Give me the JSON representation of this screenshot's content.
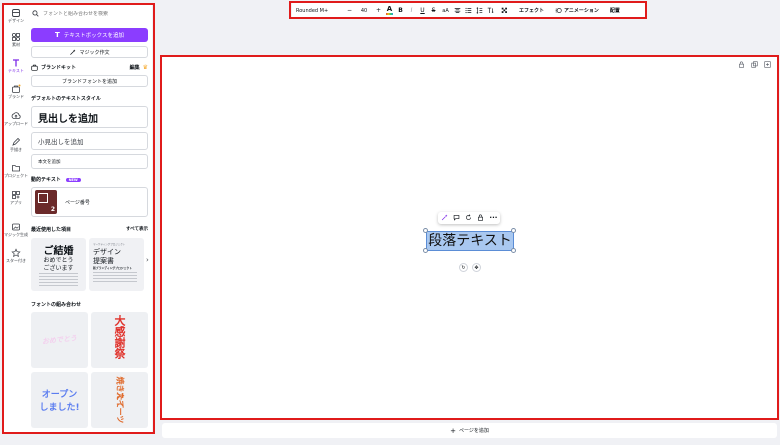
{
  "rail": {
    "items": [
      {
        "label": "デザイン",
        "icon": "design-icon"
      },
      {
        "label": "素材",
        "icon": "elements-icon"
      },
      {
        "label": "テキスト",
        "icon": "text-icon"
      },
      {
        "label": "ブランド",
        "icon": "brand-icon"
      },
      {
        "label": "アップロード",
        "icon": "upload-icon"
      },
      {
        "label": "手描き",
        "icon": "draw-icon"
      },
      {
        "label": "プロジェクト",
        "icon": "folder-icon"
      },
      {
        "label": "アプリ",
        "icon": "apps-icon"
      },
      {
        "label": "マジック生成",
        "icon": "magic-media-icon"
      },
      {
        "label": "スター付き",
        "icon": "star-icon"
      }
    ]
  },
  "panel": {
    "search_placeholder": "フォントと組み合わせを検索",
    "add_textbox_label": "テキストボックスを追加",
    "magic_write_label": "マジック作文",
    "brand_kit_label": "ブランドキット",
    "edit_label": "編集",
    "add_brand_font_label": "ブランドフォントを追加",
    "default_styles_title": "デフォルトのテキストスタイル",
    "heading_label": "見出しを追加",
    "subheading_label": "小見出しを追加",
    "body_label": "本文を追加",
    "dynamic_text_title": "動的テキスト",
    "new_badge": "NEW",
    "page_number_label": "ページ番号",
    "page_number_digit": "2",
    "recent_title": "最近使用した項目",
    "see_all_label": "すべて表示",
    "recent_card_1": {
      "line1": "ご結婚",
      "line2": "おめでとう",
      "line3": "ございます"
    },
    "recent_card_2": {
      "line0": "マーケティングプロジェクト",
      "line1": "デザイン",
      "line2": "提案書",
      "line3": "新ブランディングプロジェクト"
    },
    "combos_title": "フォントの組み合わせ",
    "combo_1": "おめでとう",
    "combo_2": "大感謝祭",
    "combo_3_line1": "オープン",
    "combo_3_line2": "しました!",
    "combo_4_line1": "焼きたて",
    "combo_4_line2": "スイーツ"
  },
  "toolbar": {
    "font_name": "Rounded M+",
    "minus": "−",
    "size": "40",
    "plus": "+",
    "text_color": "A",
    "bold": "B",
    "italic": "I",
    "underline": "U",
    "strike": "S",
    "case": "aA",
    "effects_label": "エフェクト",
    "animate_label": "アニメーション",
    "position_label": "配置"
  },
  "canvas": {
    "text_content": "段落テキスト"
  },
  "add_page_label": "ページを追加",
  "colors": {
    "accent": "#8b3dff",
    "annotation": "#e01b1b",
    "selection": "#a9c8f0"
  }
}
